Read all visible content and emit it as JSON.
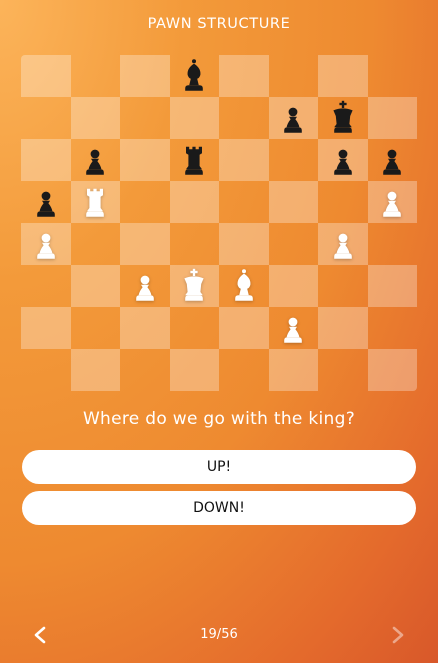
{
  "header": {
    "title": "PAWN STRUCTURE"
  },
  "board": {
    "light_square_overlay": "rgba(255,255,255,0.30)",
    "white_piece_color": "#ffffff",
    "black_piece_color": "#1a1a1a",
    "rows": [
      [
        null,
        null,
        null,
        "bB",
        null,
        null,
        null,
        null
      ],
      [
        null,
        null,
        null,
        null,
        null,
        "bP",
        "bK",
        null
      ],
      [
        null,
        "bP",
        null,
        "bR",
        null,
        null,
        "bP",
        "bP"
      ],
      [
        "bP",
        "wR",
        null,
        null,
        null,
        null,
        null,
        "wP"
      ],
      [
        "wP",
        null,
        null,
        null,
        null,
        null,
        "wP",
        null
      ],
      [
        null,
        null,
        "wP",
        "wK",
        "wB",
        null,
        null,
        null
      ],
      [
        null,
        null,
        null,
        null,
        null,
        "wP",
        null,
        null
      ],
      [
        null,
        null,
        null,
        null,
        null,
        null,
        null,
        null
      ]
    ]
  },
  "prompt": {
    "question": "Where do we go with the king?"
  },
  "options": {
    "up_label": "UP!",
    "down_label": "DOWN!"
  },
  "footer": {
    "counter": "19/56",
    "prev_icon": "chevron-left-icon",
    "next_icon": "chevron-right-icon",
    "next_enabled": false
  }
}
